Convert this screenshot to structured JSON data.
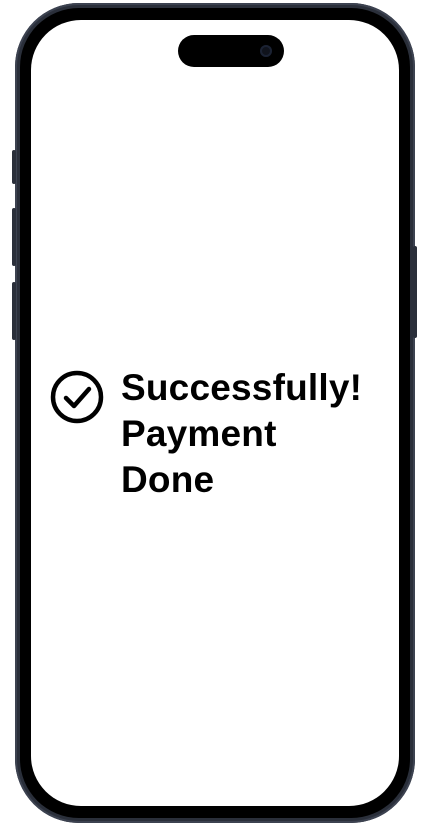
{
  "screen": {
    "message_lines": [
      "Successfully!",
      "Payment",
      "Done"
    ],
    "status_icon": "check-circle-icon"
  },
  "colors": {
    "frame": "#2a2f3a",
    "bezel": "#000000",
    "screen_background": "#ffffff",
    "text": "#000000"
  }
}
